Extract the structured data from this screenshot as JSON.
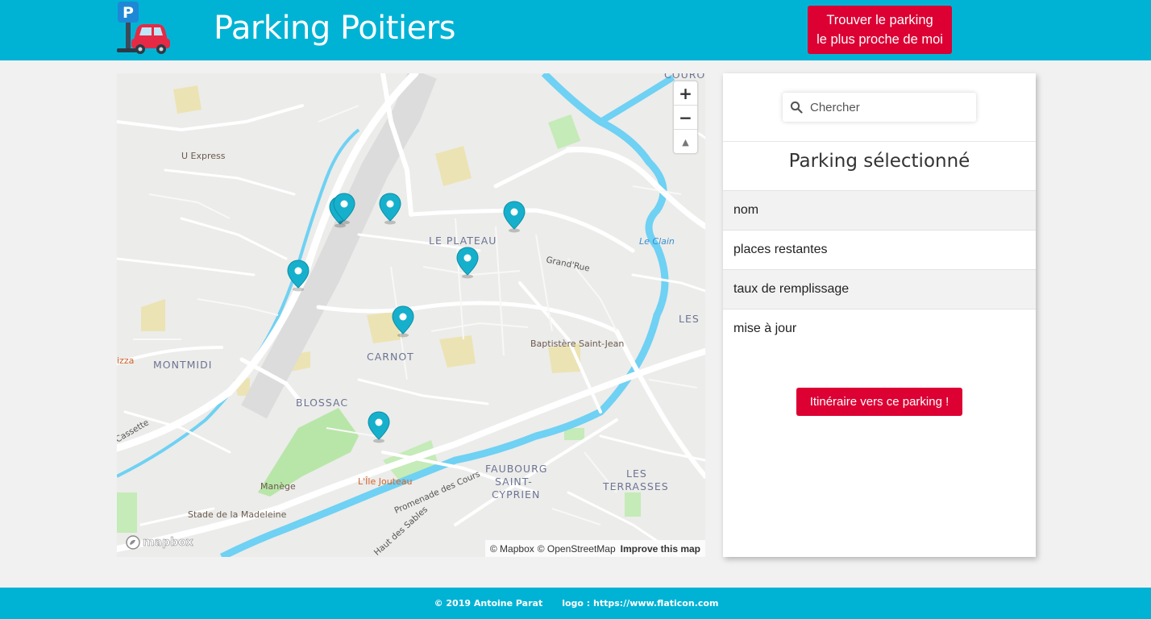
{
  "header": {
    "logo_icon": "parking-car-icon",
    "title": "Parking Poitiers",
    "find_nearest_line1": "Trouver le parking",
    "find_nearest_line2": "le plus proche de moi"
  },
  "map": {
    "district_labels": [
      "LE PLATEAU",
      "CARNOT",
      "BLOSSAC",
      "MONTMIDI",
      "FAUBOURG",
      "SAINT-",
      "CYPRIEN",
      "LES",
      "TERRASSES",
      "LES",
      "COURON"
    ],
    "poi_labels": [
      "U Express",
      "Baptistère Saint-Jean",
      "Manège",
      "Stade de la Madeleine"
    ],
    "orange_labels": [
      "L'Île Jouteau",
      "izza"
    ],
    "water_labels": [
      "Le Clain"
    ],
    "street_labels": [
      "Grand'Rue",
      "Promenade des Cours",
      "Haut des Sables",
      "Cassette"
    ],
    "zoom": {
      "in_label": "+",
      "out_label": "−",
      "compass_label": "▲"
    },
    "brand": "mapbox",
    "attribution": {
      "mapbox": "© Mapbox",
      "osm": "© OpenStreetMap",
      "improve": "Improve this map"
    },
    "marker_icon": "map-pin-icon",
    "marker_color": "#16b0cc"
  },
  "panel": {
    "search": {
      "placeholder": "Chercher",
      "value": ""
    },
    "heading": "Parking sélectionné",
    "rows": [
      "nom",
      "places restantes",
      "taux de remplissage",
      "mise à jour"
    ],
    "itinerary_button": "Itinéraire vers ce parking !"
  },
  "footer": {
    "copyright": "© 2019 Antoine Parat",
    "credit": "logo : https://www.flaticon.com"
  },
  "colors": {
    "brand": "#00b3d5",
    "accent_red": "#dc0033",
    "water": "#6fd1f3",
    "park": "#b8e6a8"
  }
}
